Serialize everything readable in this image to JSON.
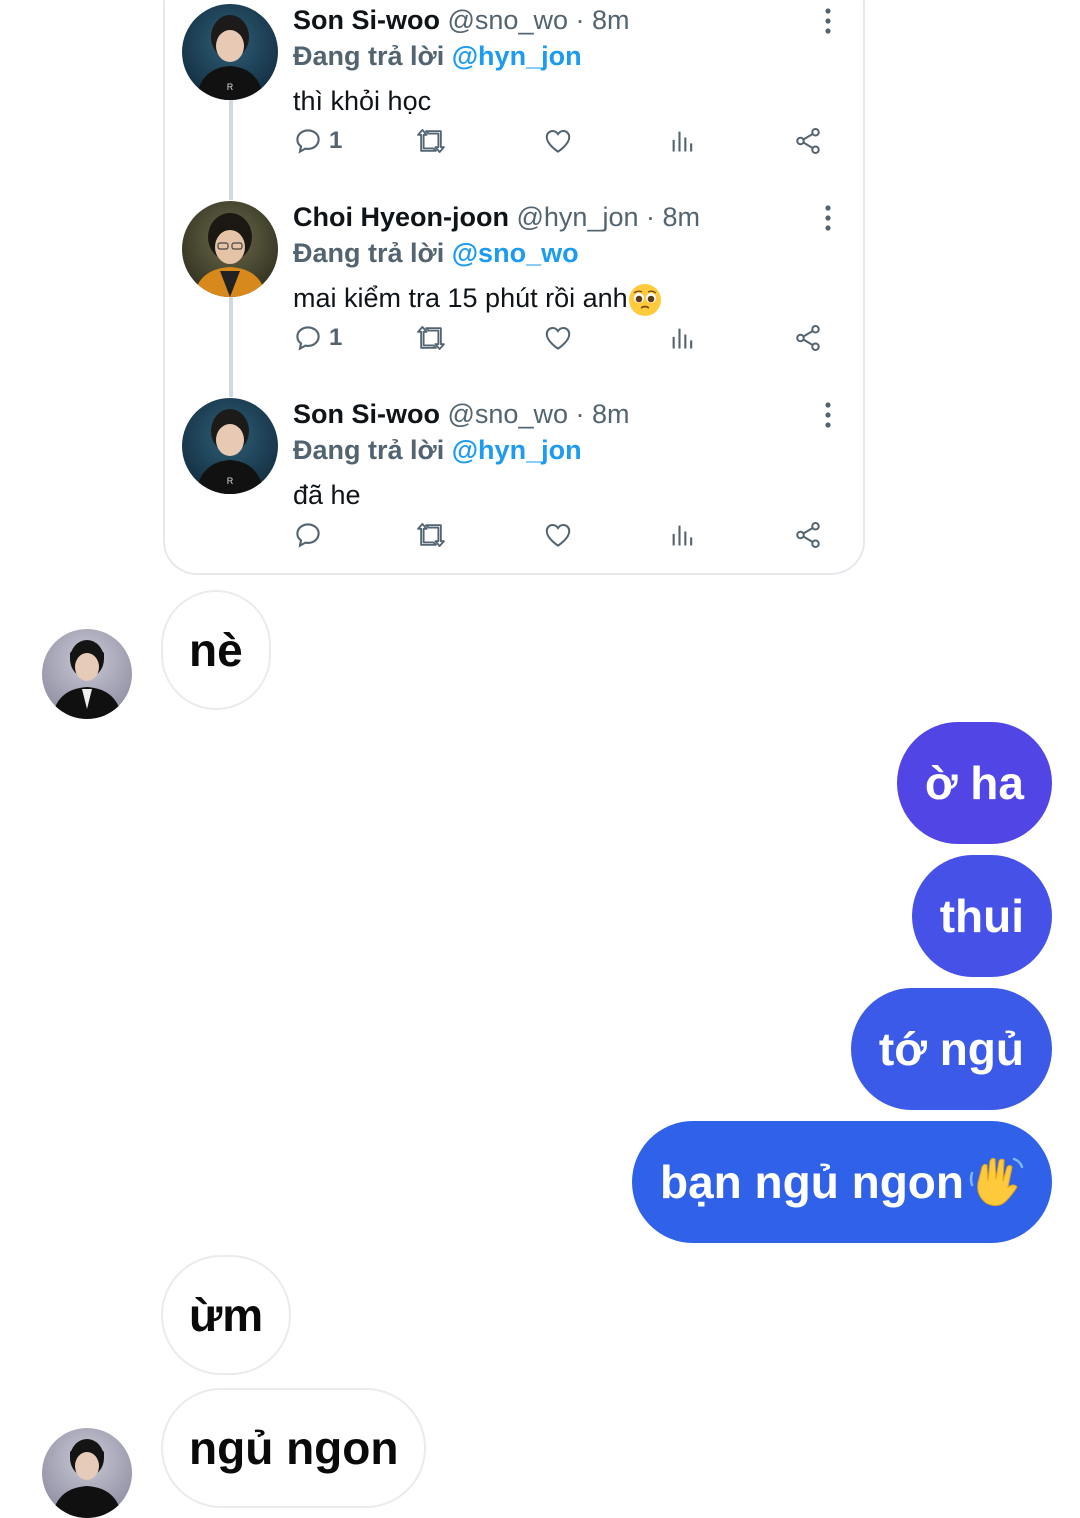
{
  "thread": {
    "tweets": [
      {
        "name": "Son Si-woo",
        "handle": "@sno_wo",
        "time": "· 8m",
        "reply_prefix": "Đang trả lời",
        "reply_to": "@hyn_jon",
        "text": "thì khỏi học",
        "reply_count": "1"
      },
      {
        "name": "Choi Hyeon-joon",
        "handle": "@hyn_jon",
        "time": "· 8m",
        "reply_prefix": "Đang trả lời",
        "reply_to": "@sno_wo",
        "text": "mai kiểm tra 15 phút rồi anh",
        "emoji": "pleading-face-emoji",
        "reply_count": "1"
      },
      {
        "name": "Son Si-woo",
        "handle": "@sno_wo",
        "time": "· 8m",
        "reply_prefix": "Đang trả lời",
        "reply_to": "@hyn_jon",
        "text": "đã he",
        "reply_count": ""
      }
    ]
  },
  "chat": {
    "incoming": [
      {
        "text": "nè"
      },
      {
        "text": "ừm"
      },
      {
        "text": "ngủ ngon"
      }
    ],
    "outgoing": [
      {
        "text": "ờ ha"
      },
      {
        "text": "thui"
      },
      {
        "text": "tớ ngủ"
      },
      {
        "text": "bạn ngủ ngon",
        "emoji": "waving-hand-emoji"
      }
    ]
  },
  "icons": {
    "reply": "comment-icon",
    "retweet": "retweet-icon",
    "like": "heart-icon",
    "views": "views-icon",
    "share": "share-icon",
    "more": "more-vertical-icon"
  },
  "colors": {
    "mention": "#1d9bf0",
    "secondary_text": "#536471",
    "outgoing_gradient_top": "#5443e6",
    "outgoing_gradient_bottom": "#2f62e8",
    "incoming_border": "#ebebeb"
  }
}
